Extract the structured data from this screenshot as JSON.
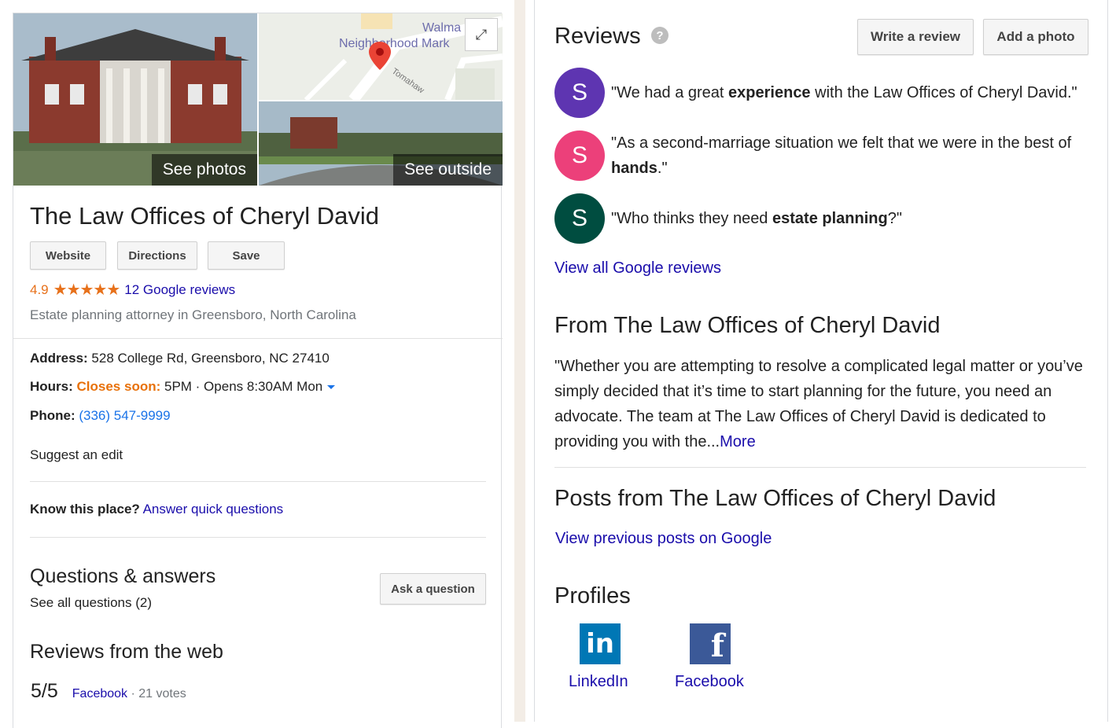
{
  "photos": {
    "see_photos": "See photos",
    "see_outside": "See outside",
    "map_labels": [
      "Walma",
      "Neighborhood Mark",
      "Tomahaw"
    ]
  },
  "business": {
    "name": "The Law Offices of Cheryl David",
    "buttons": {
      "website": "Website",
      "directions": "Directions",
      "save": "Save"
    },
    "rating": "4.9",
    "stars": "★★★★★",
    "reviews_link": "12 Google reviews",
    "category": "Estate planning attorney in Greensboro, North Carolina"
  },
  "details": {
    "address_label": "Address:",
    "address": "528 College Rd, Greensboro, NC 27410",
    "hours_label": "Hours:",
    "closes_soon": "Closes soon:",
    "hours_rest": "5PM · Opens 8:30AM Mon",
    "phone_label": "Phone:",
    "phone": "(336) 547-9999",
    "suggest_edit": "Suggest an edit",
    "know_place": "Know this place?",
    "answer_questions": "Answer quick questions"
  },
  "qa": {
    "title": "Questions & answers",
    "see_all": "See all questions (2)",
    "ask_button": "Ask a question"
  },
  "web_reviews": {
    "title": "Reviews from the web",
    "score": "5/5",
    "source": "Facebook",
    "votes": "· 21 votes"
  },
  "reviews": {
    "title": "Reviews",
    "write_review": "Write a review",
    "add_photo": "Add a photo",
    "items": [
      {
        "initial": "S",
        "color": "#5e35b1",
        "pre": "\"We had a great ",
        "bold": "experience",
        "post": " with the Law Offices of Cheryl David.\""
      },
      {
        "initial": "S",
        "color": "#ec407a",
        "pre": "\"As a second-marriage situation we felt that we were in the best of ",
        "bold": "hands",
        "post": ".\""
      },
      {
        "initial": "S",
        "color": "#004d40",
        "pre": "\"Who thinks they need ",
        "bold": "estate planning",
        "post": "?\""
      }
    ],
    "view_all": "View all Google reviews"
  },
  "from_section": {
    "title": "From The Law Offices of Cheryl David",
    "text": "\"Whether you are attempting to resolve a complicated legal matter or you’ve simply decided that it’s time to start planning for the future, you need an advocate. The team at The Law Offices of Cheryl David is dedicated to providing you with the...",
    "more": "More"
  },
  "posts": {
    "title": "Posts from The Law Offices of Cheryl David",
    "link": "View previous posts on Google"
  },
  "profiles": {
    "title": "Profiles",
    "linkedin": "LinkedIn",
    "facebook": "Facebook"
  },
  "colors": {
    "accent_orange": "#e7711b",
    "link_blue": "#1a0dab",
    "linkedin": "#0077b5",
    "facebook": "#3b5998"
  }
}
